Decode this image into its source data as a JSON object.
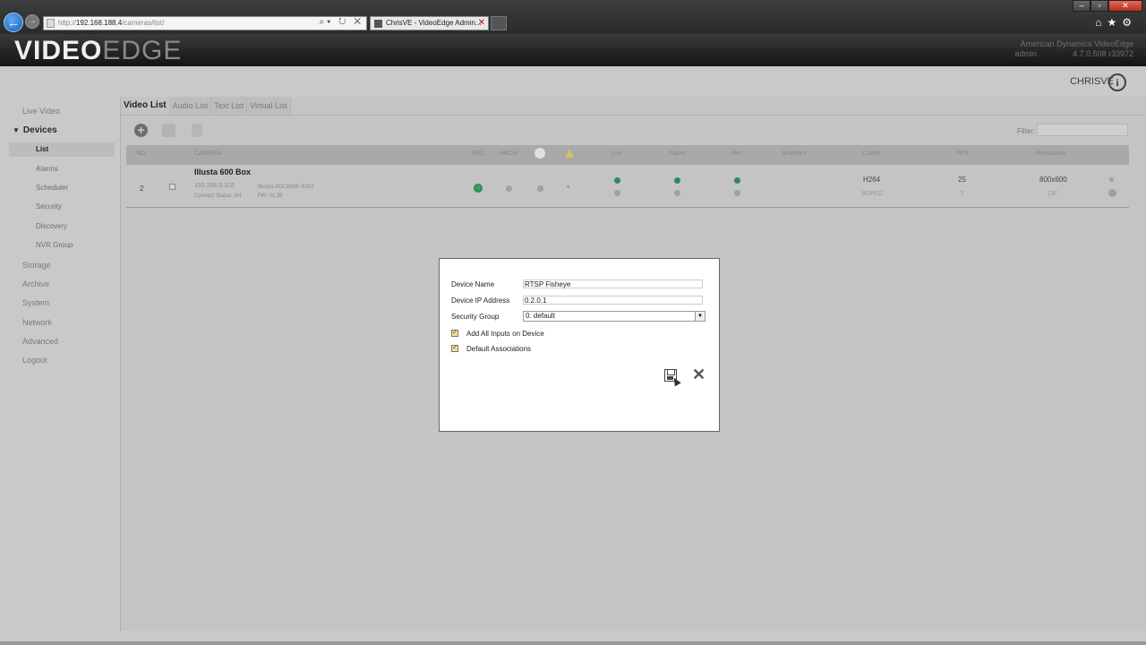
{
  "browser": {
    "url_prefix": "http://",
    "url_host": "192.168.188.4",
    "url_path": "/cameras/list/",
    "addr_icons": "⌕▾ ↻ ✕",
    "tab_title": "ChrisVE - VideoEdge Admin...",
    "tab_close": "✕",
    "win_min": "–",
    "win_max": "▫",
    "win_close": "✕",
    "tools": "⌂★⚙",
    "back": "←",
    "forward": "→"
  },
  "header": {
    "logo_bold": "VIDEO",
    "logo_light": "EDGE",
    "company": "American Dynamics VideoEdge",
    "user": "admin",
    "version": "4.7.0.508 r33972"
  },
  "site": {
    "name": "CHRISVE",
    "info_icon_glyph": "i"
  },
  "sidebar": {
    "live_video": "Live Video",
    "devices": "Devices",
    "devices_arrow": "▼",
    "device_items": [
      "List",
      "Alarms",
      "Scheduler",
      "Security",
      "Discovery",
      "NVR Group"
    ],
    "items": [
      "Storage",
      "Archive",
      "System",
      "Network",
      "Advanced",
      "Logout"
    ]
  },
  "tabs": [
    "Video List",
    "Audio List",
    "Text List",
    "Virtual List"
  ],
  "toolbar": {
    "add_glyph": "+",
    "filter_label": "Filter:",
    "filter_value": ""
  },
  "table": {
    "headers": {
      "no": "NO.",
      "camera": "CAMERA",
      "rec": "REC",
      "arch": "ARCH",
      "live": "Live",
      "alarm": "Alarm",
      "rec2": "Rec",
      "analytics": "Analytics",
      "codec": "Codec",
      "fps": "FPS",
      "resolution": "Resolution"
    },
    "row": {
      "no": "2",
      "name": "Illusta 600 Box",
      "ip": "192.168.0.102",
      "model": "Illustra ADCi600F-X002",
      "conn": "Connect Status: AH",
      "fw": "FW: 01.39",
      "codec1": "H264",
      "codec2": "MJPEG",
      "fps1": "25",
      "fps2": "7",
      "res1": "800x600",
      "res2": "CIF"
    }
  },
  "dialog": {
    "device_name_label": "Device Name",
    "device_name_value": "RTSP Fisheye",
    "ip_label": "Device IP Address",
    "ip_value": "0.2.0.1",
    "group_label": "Security Group",
    "group_value": "0. default",
    "select_arrow": "▼",
    "check1_label": "Add All Inputs on Device",
    "check2_label": "Default Associations",
    "close_glyph": "✕"
  }
}
